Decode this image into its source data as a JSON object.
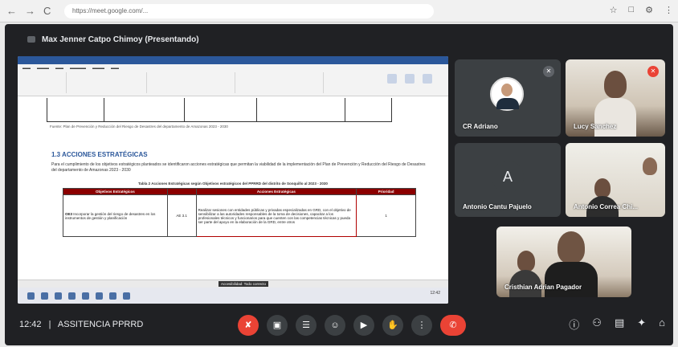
{
  "browser": {
    "url": "https://meet.google.com/...",
    "nav_back": "←",
    "nav_forward": "→",
    "nav_reload": "C",
    "tools": [
      "☆",
      "□",
      "⚙",
      "⋮"
    ]
  },
  "meet": {
    "presenter_label": "Max Jenner Catpo Chimoy (Presentando)",
    "meeting_time": "12:42",
    "meeting_name": "ASSITENCIA PPRRD",
    "separator": "|"
  },
  "document": {
    "caption": "Fuente: Plan de Prevención y Reducción del Riesgo de Desastres del departamento de Amazonas 2023 - 2030",
    "section_title": "1.3   ACCIONES ESTRATÉGICAS",
    "paragraph": "Para el cumplimiento de los objetivos estratégicos planteados se identificaron acciones estratégicas que permitan la viabilidad de la implementación del Plan de Prevención y Reducción del Riesgo de Desastres del departamento de Amazonas 2023 - 2030",
    "table_title": "Tabla 2 Acciones Estratégicas según Objetivos estratégicos del PPRRD del distrito de Sonquillo al 2023 - 2030",
    "table": {
      "headers": [
        "Objetivos Estratégicos",
        "",
        "Acciones Estratégicas",
        "Prioridad"
      ],
      "row": {
        "code": "OE3",
        "objective": "Incorporar la gestión del riesgo de desastres en los instrumentos de gestión y planificación",
        "ae_code": "AE 3.1",
        "action": "Realizar sesiones con entidades públicas y privadas especializadas en GRD, con el objetivo de sensibilizar a las autoridades responsables de la toma de decisiones, capacitar a los profesionales técnicos y funcionarios para que cuenten con las competencias técnicas y pueda ser parte del apoyo en la elaboración de la GRD, entre otros",
        "priority": "1"
      }
    },
    "status_label": "Accesibilidad: Todo correcto"
  },
  "participants": [
    {
      "name": "CR Adriano",
      "type": "photo-avatar",
      "muted": true
    },
    {
      "name": "Lucy Sanchez",
      "type": "camera",
      "muted": false
    },
    {
      "name": "Antonio Cantu Pajuelo",
      "type": "letter-avatar",
      "letter": "A",
      "muted": false
    },
    {
      "name": "Antonio Correa Chi...",
      "type": "camera",
      "muted": false
    },
    {
      "name": "Cristhian Adrian Pagador",
      "type": "camera",
      "muted": false
    }
  ],
  "controls": {
    "mic": "✘",
    "camera": "▣",
    "captions": "☰",
    "emoji": "☺",
    "present": "▶",
    "raise_hand": "✋",
    "more": "⋮",
    "end_call": "✆"
  },
  "right_controls": {
    "info": "ⓘ",
    "people": "⚇",
    "chat": "▤",
    "activities": "✦",
    "lock": "⌂"
  },
  "colors": {
    "meet_bg": "#202124",
    "tile_bg": "#3c4043",
    "mic_off_red": "#ea4335",
    "table_header": "#8b0000"
  }
}
